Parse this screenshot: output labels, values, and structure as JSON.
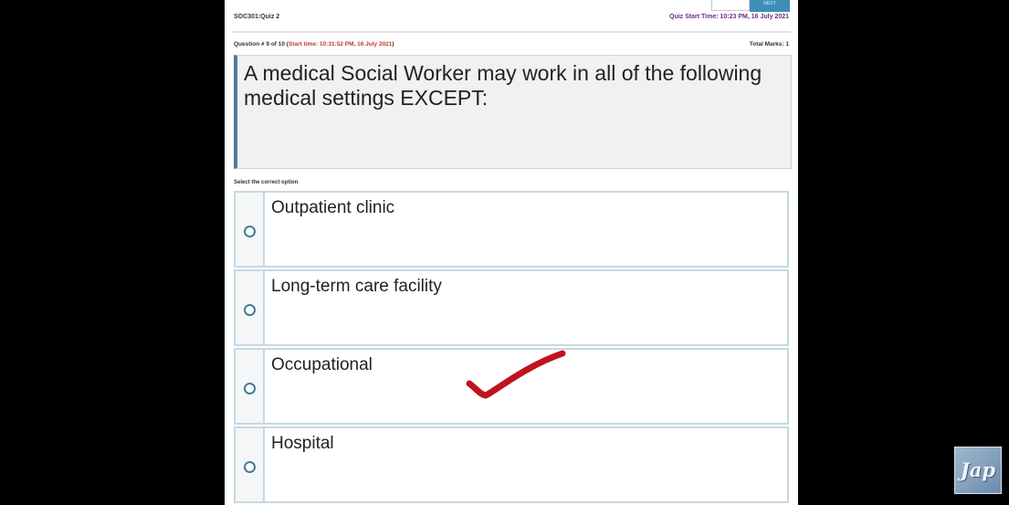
{
  "header": {
    "course": "SOC301:Quiz 2",
    "quiz_start": "Quiz Start Time: 10:23 PM, 16 July 2021",
    "top_button_label": "NEXT"
  },
  "question": {
    "number_prefix": "Question # 9 of 10 (",
    "start_time": "Start time: 10:31:52 PM, 16 July 2021",
    "number_suffix": ")",
    "total_marks": "Total Marks: 1",
    "text": "A medical Social Worker may work in all of the following medical settings EXCEPT:"
  },
  "select_label": "Select the correct option",
  "options": [
    {
      "label": "Outpatient clinic"
    },
    {
      "label": "Long-term care facility"
    },
    {
      "label": "Occupational"
    },
    {
      "label": "Hospital"
    }
  ],
  "annotation": {
    "mark": "checkmark",
    "color": "#c0141c",
    "marked_option": "Occupational"
  },
  "watermark": {
    "text": "Jap"
  }
}
